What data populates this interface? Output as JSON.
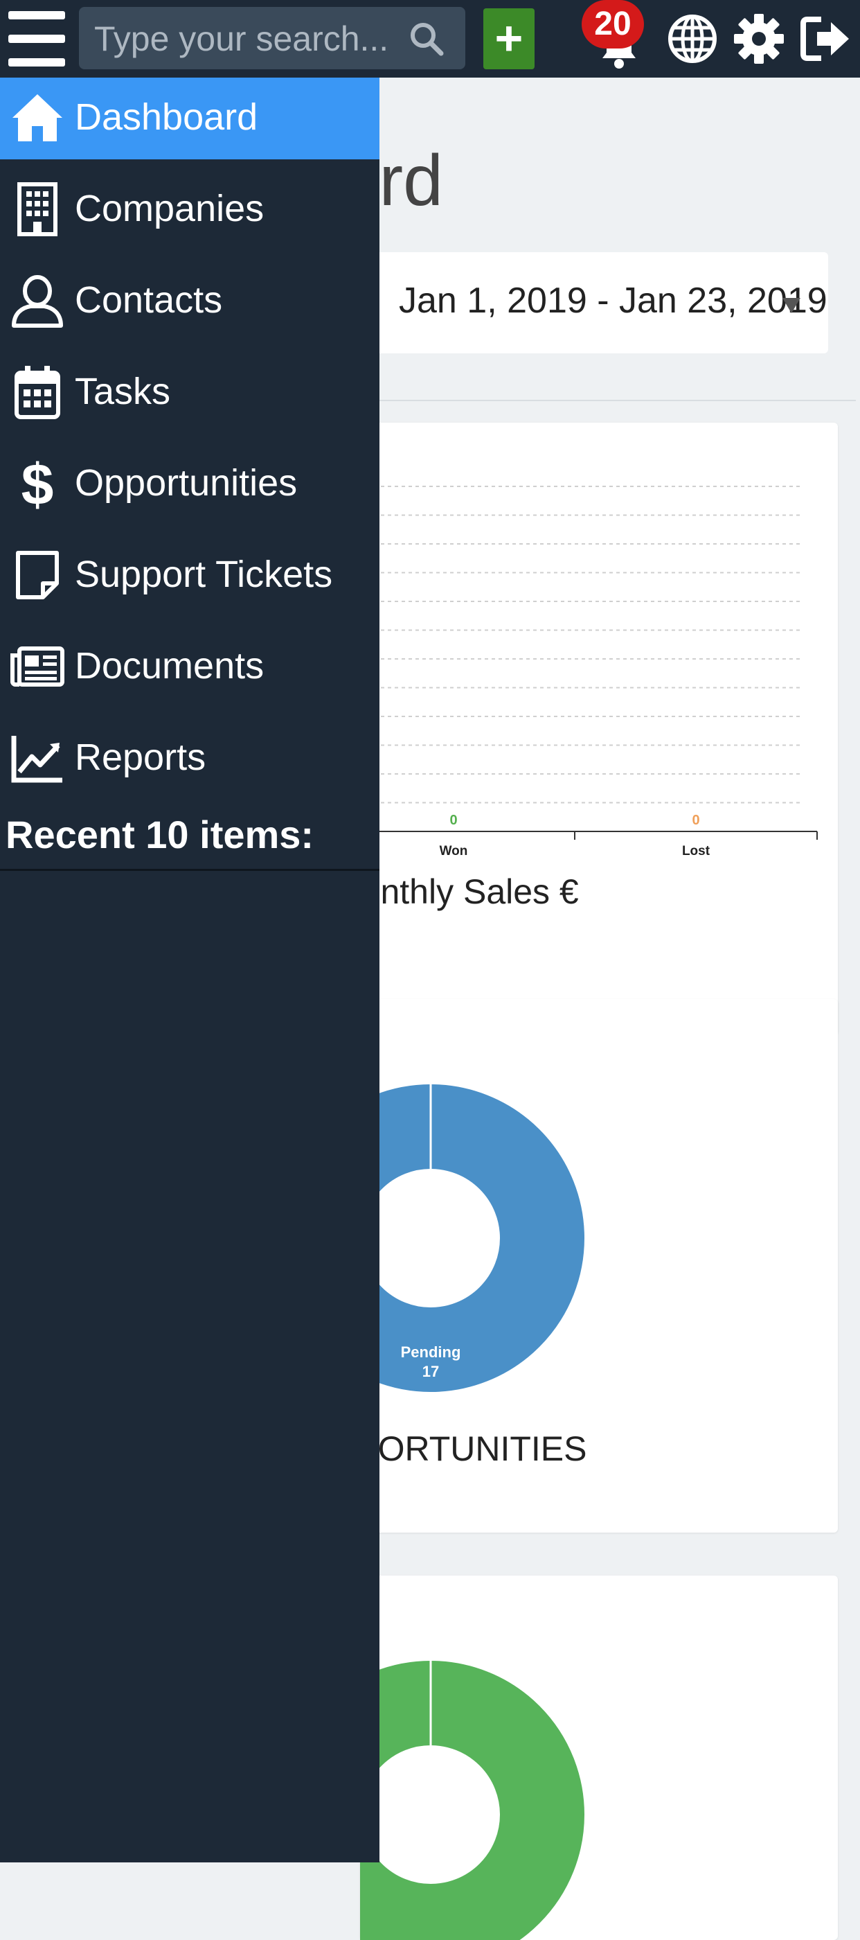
{
  "topbar": {
    "search_placeholder": "Type your search...",
    "add_label": "+",
    "notification_count": "20"
  },
  "main": {
    "title": "Dashboard",
    "date_range": "Jan 1, 2019 - Jan 23, 2019",
    "sales_card": {
      "caption": "Monthly Sales €"
    },
    "opportunities_card": {
      "caption": "OPPORTUNITIES"
    }
  },
  "sidebar": {
    "items": [
      {
        "label": "Dashboard",
        "icon": "home-icon",
        "active": true
      },
      {
        "label": "Companies",
        "icon": "building-icon"
      },
      {
        "label": "Contacts",
        "icon": "user-icon"
      },
      {
        "label": "Tasks",
        "icon": "calendar-icon"
      },
      {
        "label": "Opportunities",
        "icon": "dollar-icon"
      },
      {
        "label": "Support Tickets",
        "icon": "sticky-note-icon"
      },
      {
        "label": "Documents",
        "icon": "newspaper-icon"
      },
      {
        "label": "Reports",
        "icon": "chart-line-icon"
      }
    ],
    "recent_title": "Recent 10 items:"
  },
  "chart_data": [
    {
      "type": "bar",
      "categories": [
        "Won",
        "Lost"
      ],
      "values": [
        0,
        0
      ],
      "data_labels": [
        "0",
        "0"
      ],
      "label_colors": [
        "#55b04f",
        "#f0a05a"
      ]
    },
    {
      "type": "pie",
      "categories": [
        "Pending"
      ],
      "values": [
        17
      ],
      "colors": [
        "#4a90c8"
      ],
      "donut": true
    },
    {
      "type": "pie",
      "categories": [],
      "values": [],
      "colors": [
        "#57b45a"
      ],
      "donut": true
    }
  ],
  "colors": {
    "sidebar_bg": "#1d2937",
    "active_item": "#3a97f5",
    "add_button": "#3c8a28",
    "badge": "#d41a1a"
  }
}
